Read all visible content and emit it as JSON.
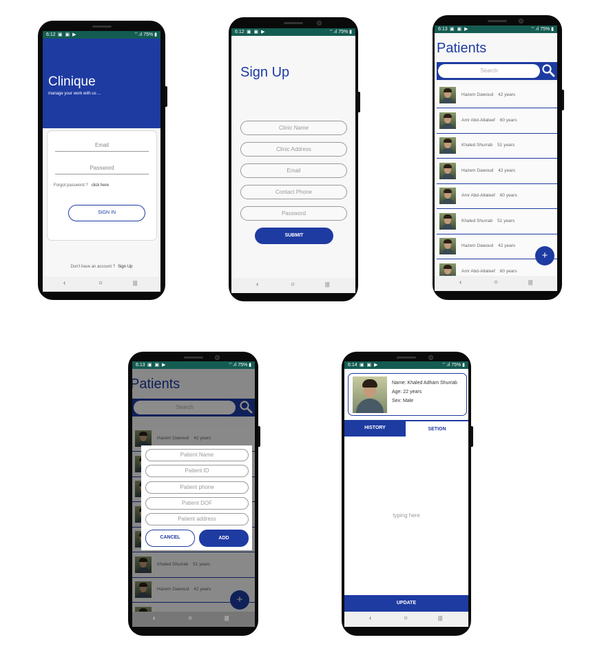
{
  "status": {
    "s1_time": "6:12",
    "s2_time": "6:12",
    "s3_time": "6:13",
    "s4_time": "6:13",
    "s5_time": "6:14",
    "battery": "75%",
    "icons": "▣ ▣ ▶"
  },
  "nav": {
    "back": "‹",
    "home": "○",
    "recents": "|||"
  },
  "login": {
    "app_name": "Clinique",
    "tagline": "manage your work with us ...",
    "email_placeholder": "Email",
    "password_placeholder": "Password",
    "forgot_text": "Forgot password ?",
    "forgot_link": "click here",
    "signin_label": "SIGN IN",
    "no_account_text": "Don't have an account ?",
    "signup_link": "Sign Up"
  },
  "signup": {
    "title": "Sign Up",
    "fields": [
      "Clinic Name",
      "Clinic Address",
      "Email",
      "Contact Phone",
      "Password"
    ],
    "submit_label": "SUBMIT"
  },
  "patients": {
    "title": "Patients",
    "search_placeholder": "Search",
    "fab_label": "+",
    "rows": [
      {
        "name": "Hazem Dawoud",
        "age": "42 years"
      },
      {
        "name": "Amr Abd-Allateef",
        "age": "60 years"
      },
      {
        "name": "Khaled Shurrab",
        "age": "51 years"
      },
      {
        "name": "Hazem Dawoud",
        "age": "42 years"
      },
      {
        "name": "Amr Abd-Allateef",
        "age": "60 years"
      },
      {
        "name": "Khaled Shurrab",
        "age": "51 years"
      },
      {
        "name": "Hazem Dawoud",
        "age": "42 years"
      },
      {
        "name": "Amr Abd-Allateef",
        "age": "60 years"
      }
    ]
  },
  "add_dialog": {
    "fields": [
      "Patient Name",
      "Patient ID",
      "Patient phone",
      "Patient DOF",
      "Patient address"
    ],
    "cancel_label": "CANCEL",
    "add_label": "ADD"
  },
  "detail": {
    "name": "Name: Khaled Adham Shurrab",
    "age": "Age: 22 years",
    "sex": "Sex: Male",
    "tab_history": "HISTORY",
    "tab_session": "SETION",
    "placeholder": "typing here",
    "update_label": "UPDATE"
  },
  "colors": {
    "primary": "#1e3ba2",
    "status": "#145c52"
  }
}
